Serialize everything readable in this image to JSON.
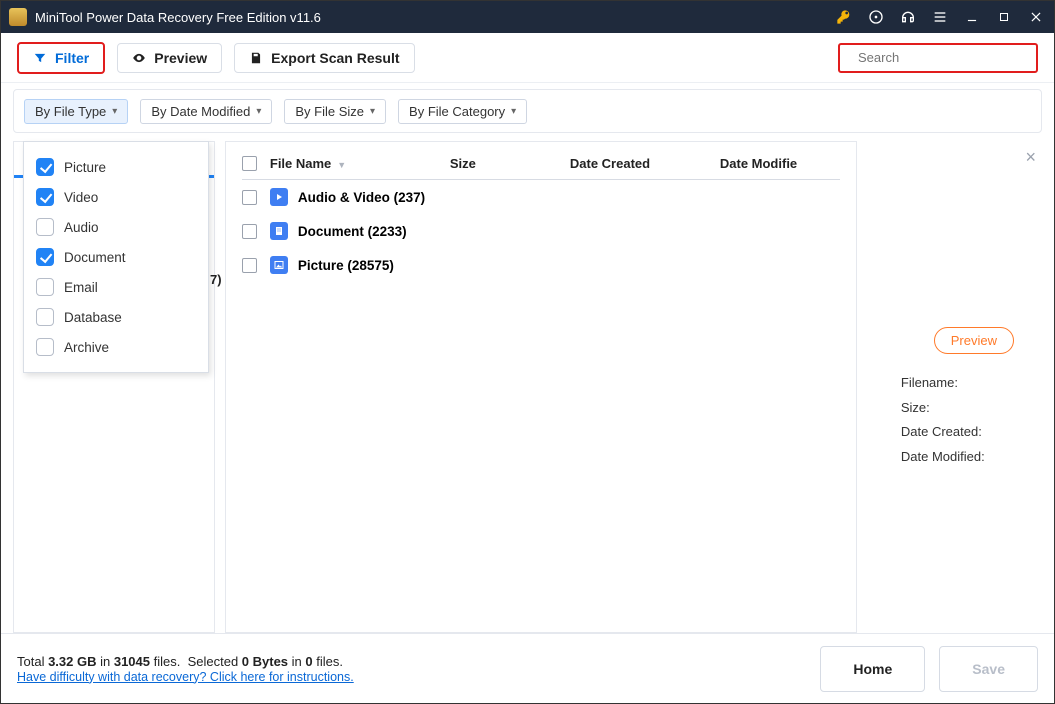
{
  "titlebar": {
    "title": "MiniTool Power Data Recovery Free Edition v11.6"
  },
  "toolbar": {
    "filter_label": "Filter",
    "preview_label": "Preview",
    "export_label": "Export Scan Result",
    "search_placeholder": "Search"
  },
  "filter_dropdowns": {
    "by_type": "By File Type",
    "by_date": "By Date Modified",
    "by_size": "By File Size",
    "by_category": "By File Category"
  },
  "type_filter_options": [
    {
      "label": "Picture",
      "checked": true
    },
    {
      "label": "Video",
      "checked": true
    },
    {
      "label": "Audio",
      "checked": false
    },
    {
      "label": "Document",
      "checked": true
    },
    {
      "label": "Email",
      "checked": false
    },
    {
      "label": "Database",
      "checked": false
    },
    {
      "label": "Archive",
      "checked": false
    }
  ],
  "leftpanel": {
    "partial_count_text": "7)"
  },
  "table": {
    "headers": {
      "filename": "File Name",
      "size": "Size",
      "created": "Date Created",
      "modified": "Date Modifie"
    },
    "rows": [
      {
        "icon": "av",
        "label": "Audio & Video (237)"
      },
      {
        "icon": "doc",
        "label": "Document (2233)"
      },
      {
        "icon": "pic",
        "label": "Picture (28575)"
      }
    ]
  },
  "preview": {
    "button_label": "Preview",
    "filename_label": "Filename:",
    "size_label": "Size:",
    "created_label": "Date Created:",
    "modified_label": "Date Modified:"
  },
  "footer": {
    "total_text_prefix": "Total ",
    "total_size": "3.32 GB",
    "in_text": " in ",
    "total_files": "31045",
    "files_text": " files.",
    "selected_prefix": "Selected ",
    "selected_bytes": "0 Bytes",
    "selected_in": " in ",
    "selected_count": "0",
    "selected_suffix": " files.",
    "help_link": "Have difficulty with data recovery? Click here for instructions.",
    "home_label": "Home",
    "save_label": "Save"
  }
}
